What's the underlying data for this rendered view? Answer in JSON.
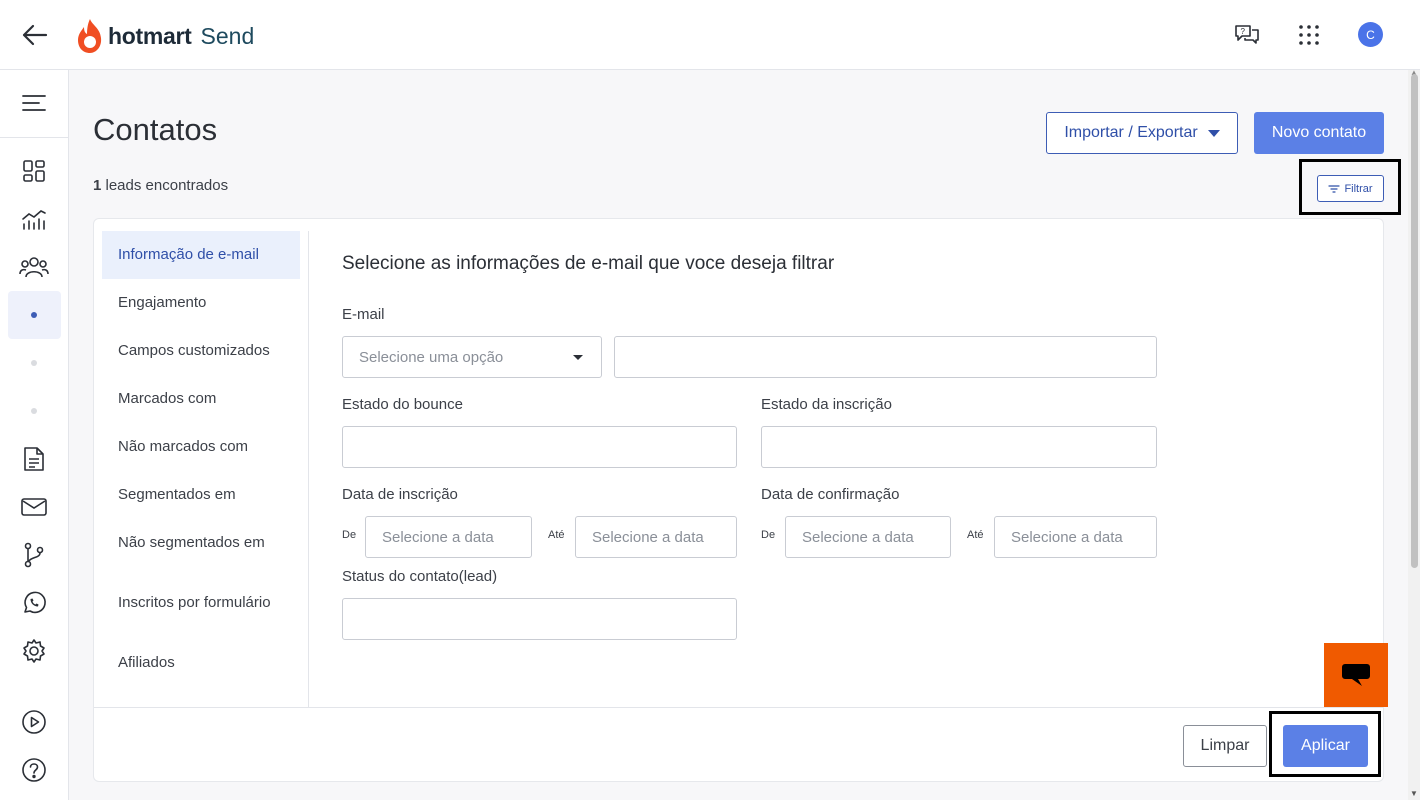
{
  "brand": {
    "name": "hotmart",
    "product": "Send",
    "accent": "#f05a00"
  },
  "header": {
    "avatar_initial": "C",
    "icons": [
      "back-arrow-icon",
      "help-chat-icon",
      "apps-grid-icon"
    ]
  },
  "sidebar": {
    "icons": [
      "menu-icon",
      "dashboard-icon",
      "analytics-icon",
      "contacts-icon",
      "dot-icon",
      "dot-icon",
      "dot-icon",
      "document-icon",
      "mail-icon",
      "automation-icon",
      "whatsapp-icon",
      "settings-icon",
      "video-icon",
      "help-icon"
    ]
  },
  "page": {
    "title": "Contatos",
    "leads_count": "1",
    "leads_label": " leads encontrados",
    "import_export_label": "Importar / Exportar",
    "new_contact_label": "Novo contato",
    "filter_label": "Filtrar"
  },
  "filter_panel": {
    "nav": [
      "Informação de e-mail",
      "Engajamento",
      "Campos customizados",
      "Marcados com",
      "Não marcados com",
      "Segmentados em",
      "Não segmentados em",
      "Inscritos por formulário",
      "Afiliados"
    ],
    "section_title": "Selecione as informações de e-mail que voce deseja filtrar",
    "email_label": "E-mail",
    "email_select_placeholder": "Selecione uma opção",
    "email_value": "",
    "bounce_label": "Estado do bounce",
    "subscription_state_label": "Estado da inscrição",
    "subscription_date_label": "Data de inscrição",
    "confirmation_date_label": "Data de confirmação",
    "from_label": "De",
    "to_label": "Até",
    "date_placeholder": "Selecione a data",
    "status_label": "Status do contato(lead)",
    "clear_label": "Limpar",
    "apply_label": "Aplicar"
  }
}
